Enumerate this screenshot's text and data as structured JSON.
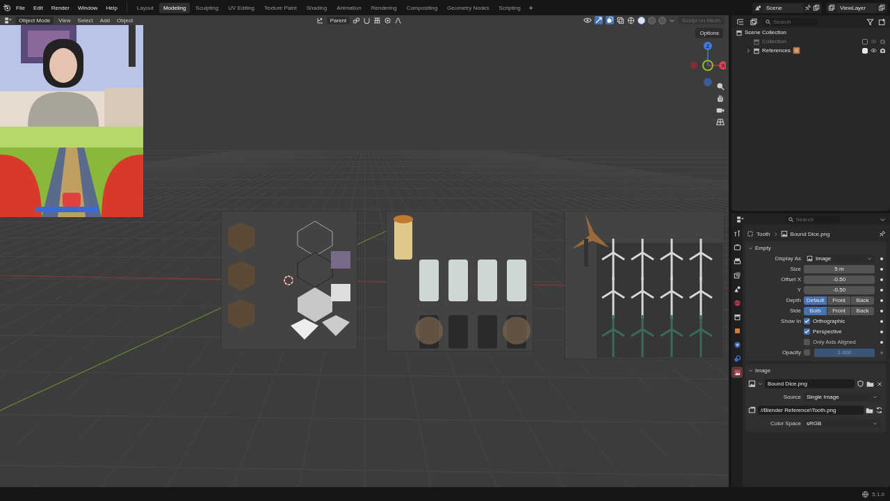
{
  "topbar": {
    "menus": [
      "File",
      "Edit",
      "Render",
      "Window",
      "Help"
    ],
    "workspaces": [
      {
        "label": "Layout",
        "selected": false
      },
      {
        "label": "Modeling",
        "selected": true
      },
      {
        "label": "Sculpting",
        "selected": false
      },
      {
        "label": "UV Editing",
        "selected": false
      },
      {
        "label": "Texture Paint",
        "selected": false
      },
      {
        "label": "Shading",
        "selected": false
      },
      {
        "label": "Animation",
        "selected": false
      },
      {
        "label": "Rendering",
        "selected": false
      },
      {
        "label": "Compositing",
        "selected": false
      },
      {
        "label": "Geometry Nodes",
        "selected": false
      },
      {
        "label": "Scripting",
        "selected": false
      }
    ],
    "add_workspace": "+",
    "scene": "Scene",
    "view_layer": "ViewLayer"
  },
  "viewport": {
    "mode": "Object Mode",
    "menus": [
      "View",
      "Select",
      "Add",
      "Object"
    ],
    "pivot": "Parent",
    "sculpt_button": {
      "label": "Sculpt on Mesh",
      "disabled": true
    },
    "shading_modes": [
      {
        "selected": false
      },
      {
        "selected": true
      },
      {
        "selected": false
      },
      {
        "selected": false
      }
    ],
    "options": "Options",
    "gizmo_labels": [
      "Z",
      "X"
    ],
    "references": [
      {
        "kind": "picture"
      },
      {
        "kind": "picture"
      },
      {
        "kind": "picture"
      }
    ]
  },
  "camera_overlay": [
    {
      "kind": "picture"
    },
    {
      "kind": "picture"
    }
  ],
  "outliner": {
    "search_placeholder": "Search",
    "root": {
      "label": "Scene Collection",
      "children": [
        {
          "label": "Collection",
          "checked": false
        },
        {
          "label": "References",
          "checked": true,
          "expanded": false
        }
      ]
    }
  },
  "properties": {
    "search_placeholder": "Search",
    "tabs": [
      {
        "selected": false
      },
      {
        "selected": false
      },
      {
        "selected": false
      },
      {
        "selected": false
      },
      {
        "selected": false
      },
      {
        "selected": false
      },
      {
        "selected": false
      },
      {
        "selected": false
      },
      {
        "selected": false
      },
      {
        "selected": false
      },
      {
        "selected": true
      }
    ],
    "breadcrumb": [
      "Tooth",
      "Bound Dice.png"
    ],
    "panels": [
      {
        "title": "Empty",
        "expanded": true,
        "rows": [
          {
            "kind": "icon_dropdown",
            "label": "Display As",
            "value": "Image"
          },
          {
            "kind": "number",
            "label": "Size",
            "value": "5 m"
          },
          {
            "kind": "number",
            "label": "Offset X",
            "value": "-0.50"
          },
          {
            "kind": "number",
            "label": "Y",
            "value": "-0.50"
          },
          {
            "kind": "segmented",
            "label": "Depth",
            "options": [
              {
                "label": "Default",
                "selected": true
              },
              {
                "label": "Front",
                "selected": false
              },
              {
                "label": "Back",
                "selected": false
              }
            ]
          },
          {
            "kind": "segmented",
            "label": "Side",
            "options": [
              {
                "label": "Both",
                "selected": true
              },
              {
                "label": "Front",
                "selected": false
              },
              {
                "label": "Back",
                "selected": false
              }
            ]
          },
          {
            "kind": "checkbox",
            "label": "Show In",
            "text": "Orthographic",
            "checked": true
          },
          {
            "kind": "checkbox",
            "text": "Perspective",
            "checked": true
          },
          {
            "kind": "checkbox",
            "text": "Only Axis Aligned",
            "checked": false
          },
          {
            "kind": "slider",
            "label": "Opacity",
            "checked": false,
            "value": "1.000",
            "level": 1,
            "disabled": true
          }
        ]
      },
      {
        "title": "Image",
        "expanded": true,
        "rows": [
          {
            "kind": "image_selector",
            "value": "Bound Dice.png"
          },
          {
            "kind": "dropdown",
            "label": "Source",
            "value": "Single Image"
          },
          {
            "kind": "filepath",
            "value": "//Blender Reference\\Tooth.png"
          },
          {
            "kind": "dropdown",
            "label": "Color Space",
            "value": "sRGB"
          }
        ]
      }
    ]
  },
  "status_bar": {
    "version": "5.1.0"
  }
}
